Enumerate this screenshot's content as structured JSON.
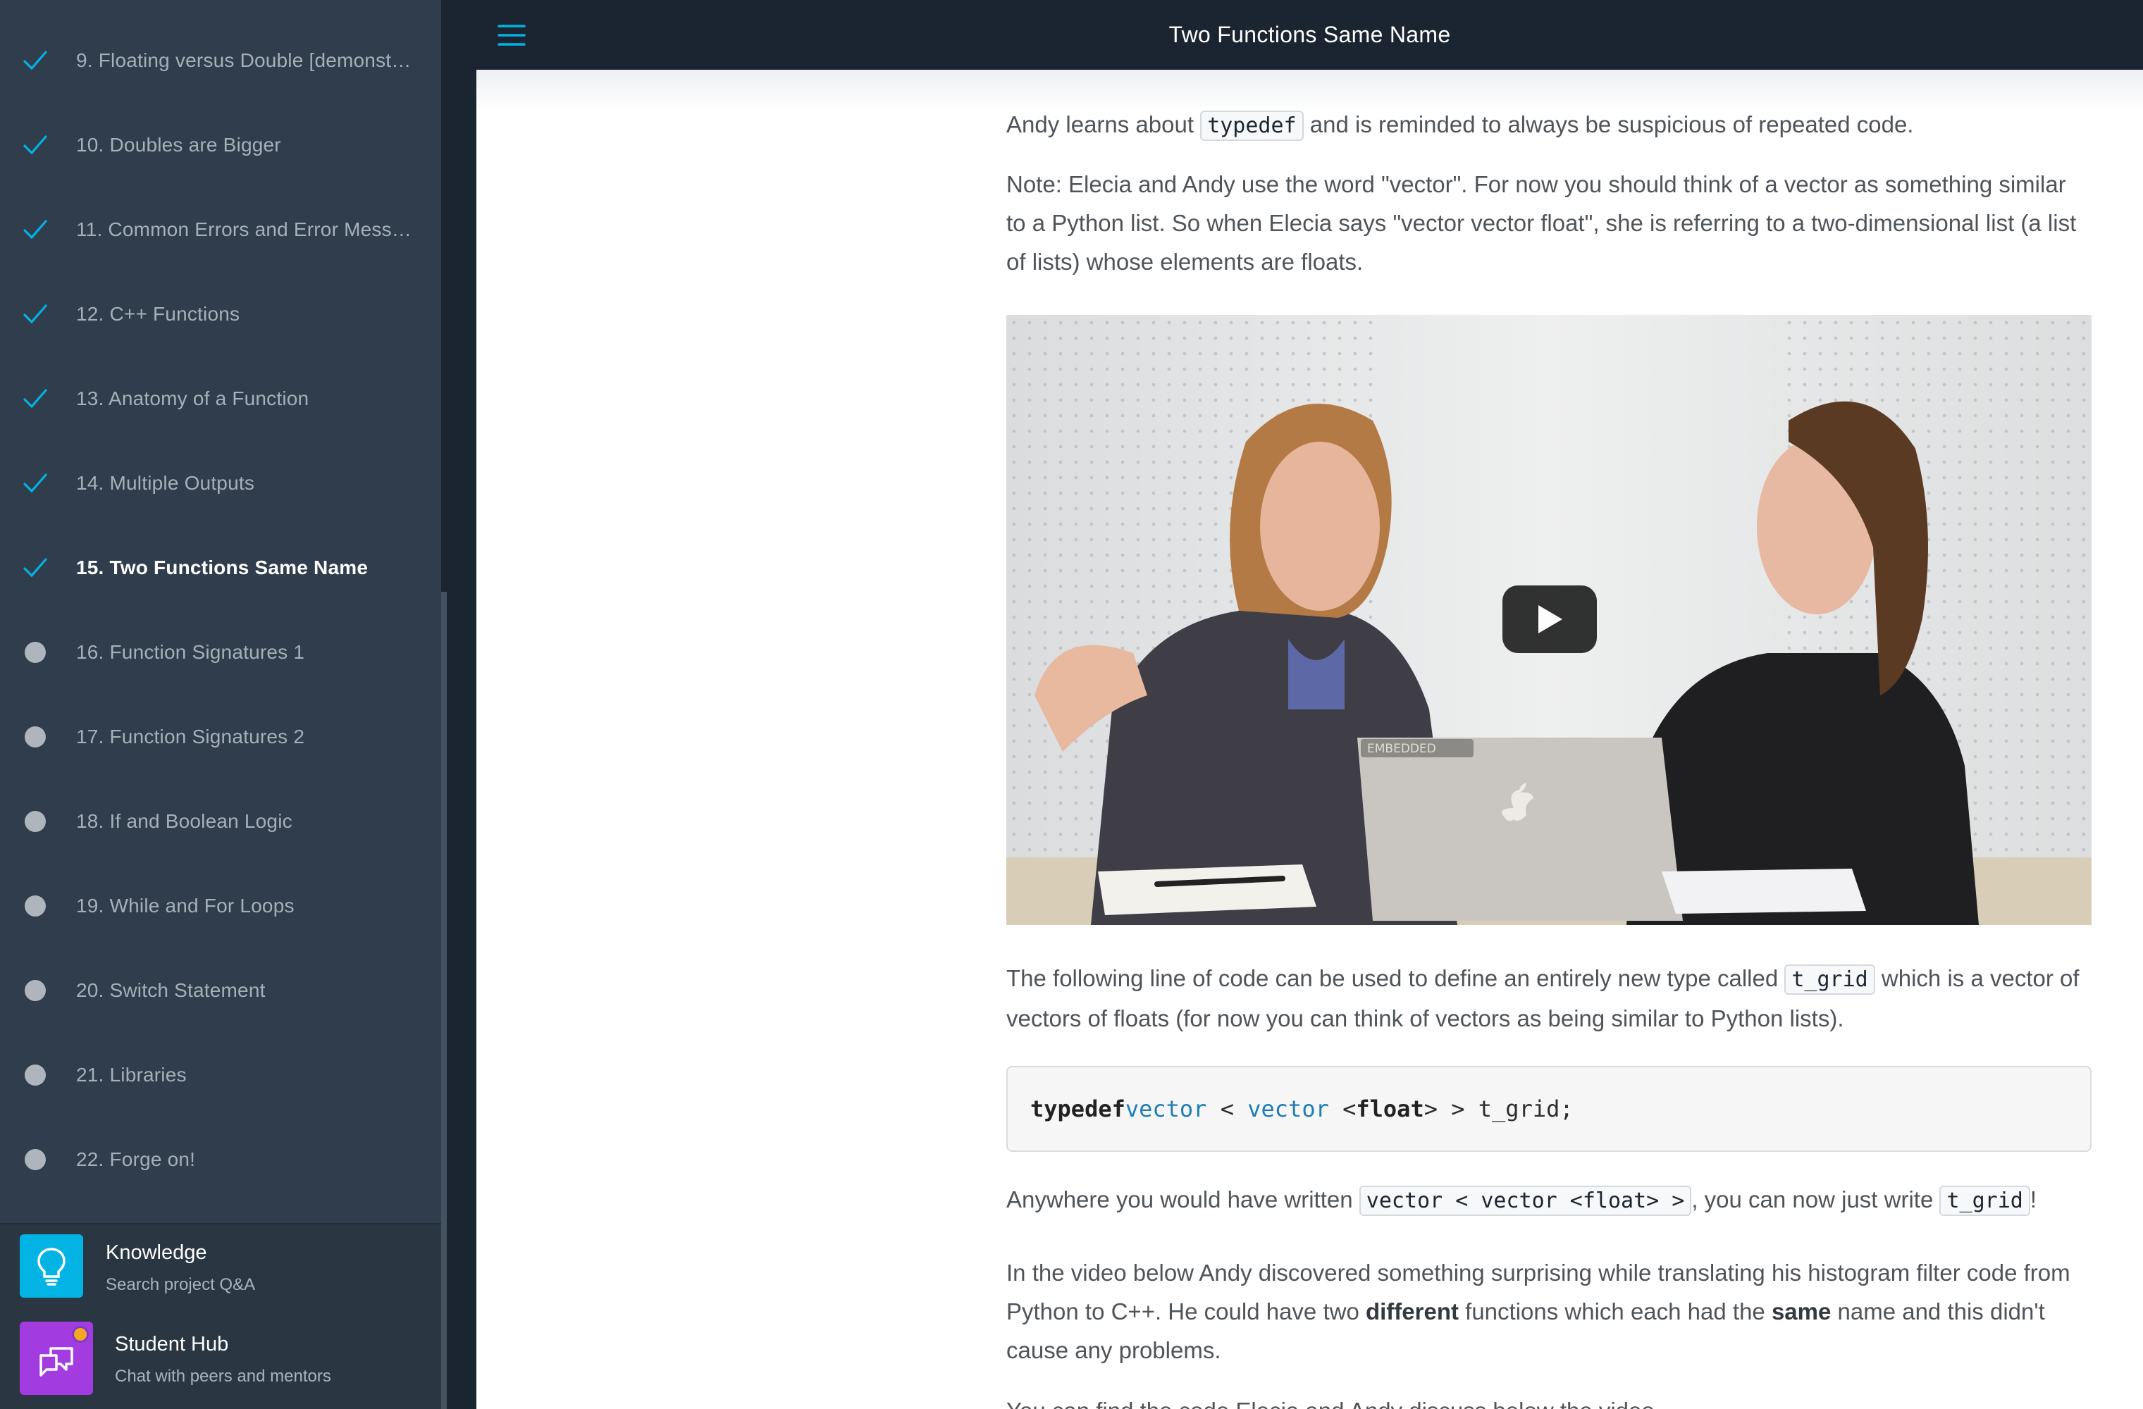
{
  "sidebar": {
    "lessons": [
      {
        "label": "9. Floating versus Double [demonst…",
        "status": "complete"
      },
      {
        "label": "10. Doubles are Bigger",
        "status": "complete"
      },
      {
        "label": "11. Common Errors and Error Mess…",
        "status": "complete"
      },
      {
        "label": "12. C++ Functions",
        "status": "complete"
      },
      {
        "label": "13. Anatomy of a Function",
        "status": "complete"
      },
      {
        "label": "14. Multiple Outputs",
        "status": "complete"
      },
      {
        "label": "15. Two Functions Same Name",
        "status": "complete-active"
      },
      {
        "label": "16. Function Signatures 1",
        "status": "incomplete"
      },
      {
        "label": "17. Function Signatures 2",
        "status": "incomplete"
      },
      {
        "label": "18. If and Boolean Logic",
        "status": "incomplete"
      },
      {
        "label": "19. While and For Loops",
        "status": "incomplete"
      },
      {
        "label": "20. Switch Statement",
        "status": "incomplete"
      },
      {
        "label": "21. Libraries",
        "status": "incomplete"
      },
      {
        "label": "22. Forge on!",
        "status": "incomplete"
      }
    ],
    "tools": [
      {
        "title": "Knowledge",
        "subtitle": "Search project Q&A",
        "icon": "lightbulb-icon",
        "color": "#02b3e4"
      },
      {
        "title": "Student Hub",
        "subtitle": "Chat with peers and mentors",
        "icon": "chat-bubbles-icon",
        "color": "#a23be0"
      }
    ]
  },
  "header": {
    "title": "Two Functions Same Name",
    "menu_icon": "hamburger-menu-icon"
  },
  "content": {
    "p1": {
      "before": "Andy learns about ",
      "code": "typedef",
      "after": " and is reminded to always be suspicious of repeated code."
    },
    "p2": "Note: Elecia and Andy use the word \"vector\". For now you should think of a vector as something similar to a Python list. So when Elecia says \"vector vector float\", she is referring to a two-dimensional list (a list of lists) whose elements are floats.",
    "video": {
      "play_icon": "play-icon",
      "laptop_sticker": "EMBEDDED"
    },
    "p3": {
      "before": "The following line of code can be used to define an entirely new type called ",
      "code": "t_grid",
      "after": " which is a vector of vectors of floats (for now you can think of vectors as being similar to Python lists)."
    },
    "code_block": {
      "keyword": "typedef",
      "type1": "vector",
      "sep1": " < ",
      "type2": "vector",
      "sep2": " <",
      "inner": "float",
      "tail": "> > t_grid;"
    },
    "p4": {
      "before": "Anywhere you would have written ",
      "code1": "vector < vector <float> >",
      "middle": ", you can now just write ",
      "code2": "t_grid",
      "after": "!"
    },
    "p5": {
      "part1": "In the video below Andy discovered something surprising while translating his histogram filter code from Python to C++. He could have two ",
      "bold1": "different",
      "part2": " functions which each had the ",
      "bold2": "same",
      "part3": " name and this didn't cause any problems."
    },
    "p6": "You can find the code Elecia and Andy discuss below the video."
  },
  "colors": {
    "sidebar_bg": "#2f3d4c",
    "topbar_bg": "#1b2531",
    "accent_check": "#02b3e4",
    "text": "#4f5459"
  }
}
